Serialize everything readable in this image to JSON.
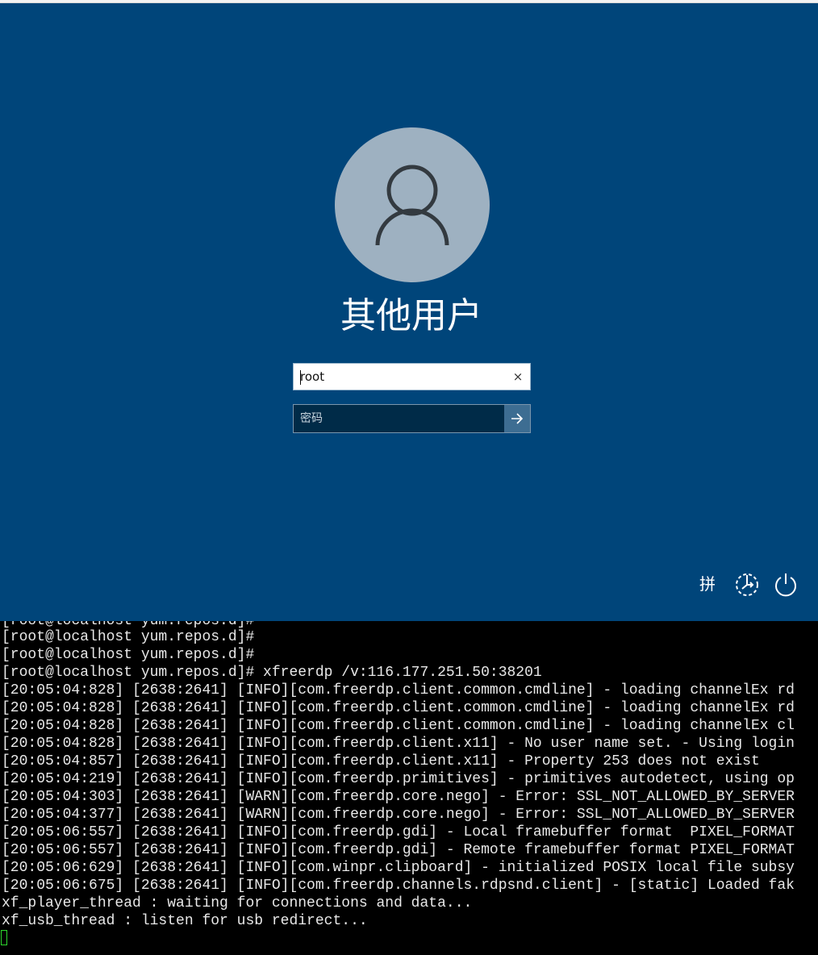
{
  "lock_screen": {
    "user_display_name": "其他用户",
    "username_value": "root",
    "clear_glyph": "×",
    "password_placeholder": "密码",
    "ime_label": "拼",
    "icons": {
      "avatar": "person-icon",
      "submit": "arrow-right-icon",
      "accessibility": "ease-of-access-icon",
      "power": "power-icon"
    },
    "colors": {
      "background": "#00457a",
      "avatar_bg": "#9eb1c1",
      "password_bg": "#002b48",
      "submit_bg": "#3d6d92"
    }
  },
  "terminal": {
    "lines": [
      "[root@localhost yum.repos.d]#",
      "[root@localhost yum.repos.d]#",
      "[root@localhost yum.repos.d]#",
      "[root@localhost yum.repos.d]# xfreerdp /v:116.177.251.50:38201",
      "[20:05:04:828] [2638:2641] [INFO][com.freerdp.client.common.cmdline] - loading channelEx rd",
      "[20:05:04:828] [2638:2641] [INFO][com.freerdp.client.common.cmdline] - loading channelEx rd",
      "[20:05:04:828] [2638:2641] [INFO][com.freerdp.client.common.cmdline] - loading channelEx cl",
      "[20:05:04:828] [2638:2641] [INFO][com.freerdp.client.x11] - No user name set. - Using login",
      "[20:05:04:857] [2638:2641] [INFO][com.freerdp.client.x11] - Property 253 does not exist",
      "[20:05:04:219] [2638:2641] [INFO][com.freerdp.primitives] - primitives autodetect, using op",
      "[20:05:04:303] [2638:2641] [WARN][com.freerdp.core.nego] - Error: SSL_NOT_ALLOWED_BY_SERVER",
      "[20:05:04:377] [2638:2641] [WARN][com.freerdp.core.nego] - Error: SSL_NOT_ALLOWED_BY_SERVER",
      "[20:05:06:557] [2638:2641] [INFO][com.freerdp.gdi] - Local framebuffer format  PIXEL_FORMAT",
      "[20:05:06:557] [2638:2641] [INFO][com.freerdp.gdi] - Remote framebuffer format PIXEL_FORMAT",
      "[20:05:06:629] [2638:2641] [INFO][com.winpr.clipboard] - initialized POSIX local file subsy",
      "[20:05:06:675] [2638:2641] [INFO][com.freerdp.channels.rdpsnd.client] - [static] Loaded fak",
      "xf_player_thread : waiting for connections and data...",
      "xf_usb_thread : listen for usb redirect..."
    ],
    "colors": {
      "background": "#000000",
      "text": "#e8e8e8",
      "cursor": "#2dd82d"
    }
  }
}
